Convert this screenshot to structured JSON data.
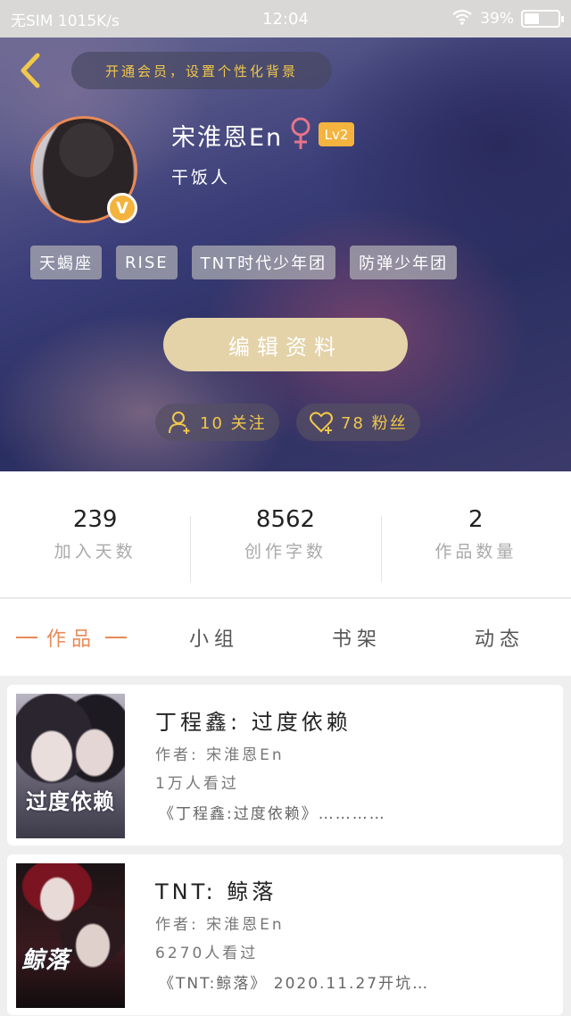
{
  "status_bar": {
    "carrier": "无SIM 1015K/s",
    "time": "12:04",
    "battery_percent": "39%",
    "battery_level": 0.39
  },
  "header": {
    "vip_banner": "开通会员，设置个性化背景"
  },
  "profile": {
    "username": "宋淮恩En",
    "gender_icon": "female-icon",
    "level": "Lv2",
    "verified_badge": "V",
    "bio": "干饭人",
    "tags": [
      "天蝎座",
      "RISE",
      "TNT时代少年团",
      "防弹少年团"
    ],
    "edit_button": "编辑资料",
    "following": "10 关注",
    "fans": "78 粉丝"
  },
  "stats": [
    {
      "value": "239",
      "label": "加入天数"
    },
    {
      "value": "8562",
      "label": "创作字数"
    },
    {
      "value": "2",
      "label": "作品数量"
    }
  ],
  "tabs": [
    {
      "label": "作品",
      "active": true
    },
    {
      "label": "小组",
      "active": false
    },
    {
      "label": "书架",
      "active": false
    },
    {
      "label": "动态",
      "active": false
    }
  ],
  "works": [
    {
      "title": "丁程鑫:  过度依赖",
      "author": "作者: 宋淮恩En",
      "views": "1万人看过",
      "excerpt": "《丁程鑫:过度依赖》…………",
      "cover_text": "过度依赖"
    },
    {
      "title": "TNT:  鲸落",
      "author": "作者: 宋淮恩En",
      "views": "6270人看过",
      "excerpt": "《TNT:鲸落》 2020.11.27开坑…",
      "cover_text": "鲸落"
    }
  ],
  "colors": {
    "accent": "#e88a57",
    "gold": "#f1c84a",
    "level_badge": "#f4b43e",
    "edit_button": "#e4d3a9"
  }
}
